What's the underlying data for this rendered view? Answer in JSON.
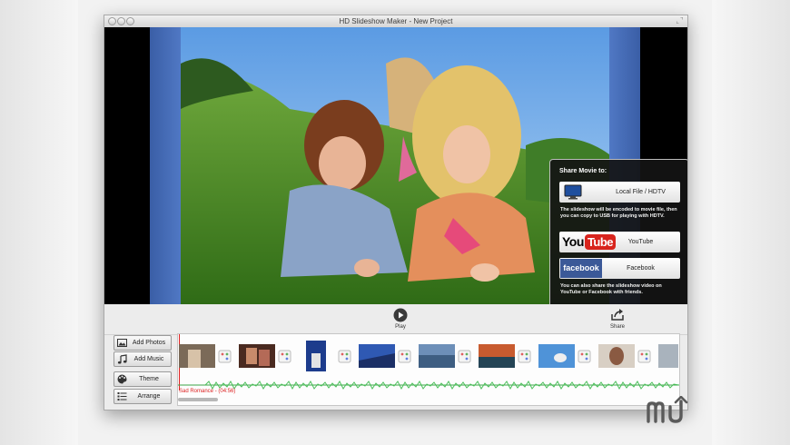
{
  "window": {
    "title": "HD Slideshow Maker - New Project"
  },
  "share": {
    "heading": "Share Movie to:",
    "local_label": "Local File / HDTV",
    "local_note": "The slideshow will be encoded to movie file, then you can copy to USB for playing with HDTV.",
    "youtube_label": "YouTube",
    "youtube_logo_you": "You",
    "youtube_logo_tube": "Tube",
    "facebook_label": "Facebook",
    "facebook_logo": "facebook",
    "social_note": "You can also share the slideshow video on YouTube or Facebook with friends."
  },
  "toolbar": {
    "play_label": "Play",
    "share_label": "Share"
  },
  "sidebar": {
    "add_photos": "Add Photos",
    "add_music": "Add Music",
    "theme": "Theme",
    "arrange": "Arrange"
  },
  "timeline": {
    "music_track": "Sad Romance - (04:56)"
  },
  "watermark": "mu"
}
